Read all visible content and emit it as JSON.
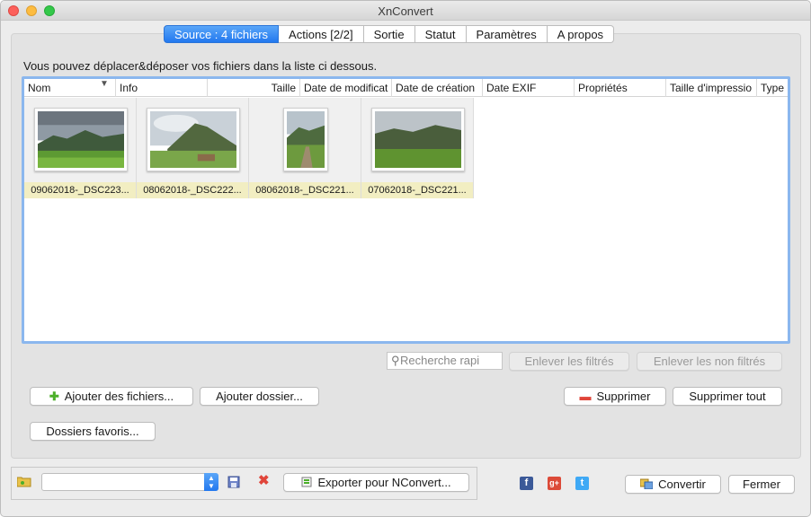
{
  "window": {
    "title": "XnConvert"
  },
  "tabs": [
    {
      "label": "Source : 4 fichiers"
    },
    {
      "label": "Actions [2/2]"
    },
    {
      "label": "Sortie"
    },
    {
      "label": "Statut"
    },
    {
      "label": "Paramètres"
    },
    {
      "label": "A propos"
    }
  ],
  "source": {
    "hint": "Vous pouvez déplacer&déposer vos fichiers dans la liste ci dessous.",
    "columns": [
      "Nom",
      "Info",
      "Taille",
      "Date de modificat",
      "Date de création",
      "Date EXIF",
      "Propriétés",
      "Taille d'impressio",
      "Type"
    ],
    "files": [
      {
        "name": "09062018-_DSC223..."
      },
      {
        "name": "08062018-_DSC222..."
      },
      {
        "name": "08062018-_DSC221..."
      },
      {
        "name": "07062018-_DSC221..."
      }
    ],
    "search_placeholder": "Recherche rapi",
    "remove_filtered": "Enlever les filtrés",
    "remove_unfiltered": "Enlever les non filtrés",
    "add_files": "Ajouter des fichiers...",
    "add_folder": "Ajouter dossier...",
    "favorites": "Dossiers favoris...",
    "delete": "Supprimer",
    "delete_all": "Supprimer tout"
  },
  "footer": {
    "export_label": "Exporter pour NConvert...",
    "convert_label": "Convertir",
    "close_label": "Fermer",
    "social": [
      "f",
      "g+",
      "t"
    ]
  },
  "colors": {
    "accent": "#2278ef",
    "list_border": "#8bb7ee",
    "caption_bg": "#f2eec2",
    "add_icon": "#4caf2a",
    "delete_icon": "#e0453a"
  }
}
